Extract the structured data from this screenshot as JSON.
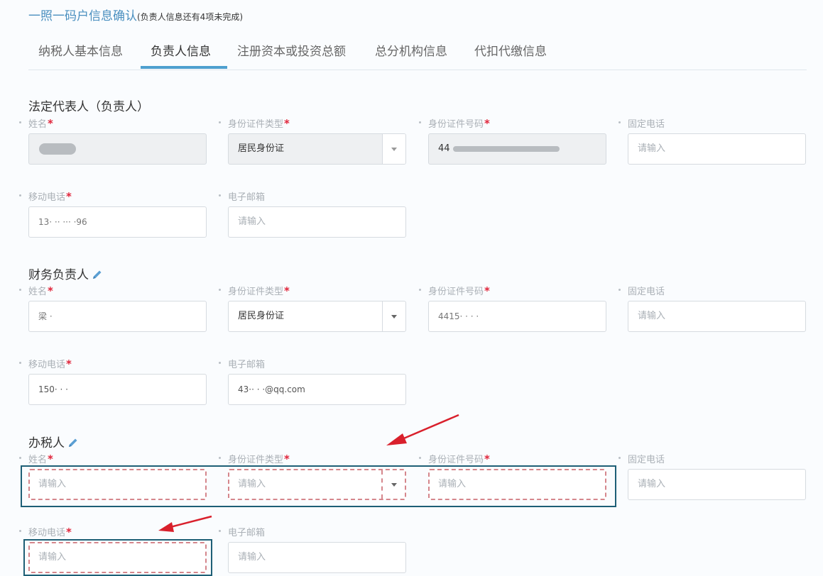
{
  "header": {
    "title": "一照一码户信息确认",
    "subtitle": "(负责人信息还有4项未完成)"
  },
  "tabs": [
    {
      "label": "纳税人基本信息"
    },
    {
      "label": "负责人信息"
    },
    {
      "label": "注册资本或投资总额"
    },
    {
      "label": "总分机构信息"
    },
    {
      "label": "代扣代缴信息"
    }
  ],
  "colors": {
    "accent": "#4ea0cf",
    "title": "#4a8fbf",
    "required": "#e0243a",
    "error_dash": "#d5868c",
    "highlight": "#1e5f76",
    "arrow": "#d9202c"
  },
  "legal_rep": {
    "title": "法定代表人（负责人）",
    "name": {
      "label": "姓名",
      "value": ""
    },
    "id_type": {
      "label": "身份证件类型",
      "value": "居民身份证"
    },
    "id_number": {
      "label": "身份证件号码",
      "value": "44"
    },
    "landline": {
      "label": "固定电话",
      "placeholder": "请输入"
    },
    "mobile": {
      "label": "移动电话",
      "value": "13· ·· ··· ·96"
    },
    "email": {
      "label": "电子邮箱",
      "placeholder": "请输入"
    }
  },
  "finance": {
    "title": "财务负责人",
    "name": {
      "label": "姓名",
      "value": "梁 ·"
    },
    "id_type": {
      "label": "身份证件类型",
      "value": "居民身份证"
    },
    "id_number": {
      "label": "身份证件号码",
      "value": "4415·           ·  · ·"
    },
    "landline": {
      "label": "固定电话",
      "placeholder": "请输入"
    },
    "mobile": {
      "label": "移动电话",
      "value": "150·  ·         ·"
    },
    "email": {
      "label": "电子邮箱",
      "value": "43·· ·  ·@qq.com"
    }
  },
  "tax_agent": {
    "title": "办税人",
    "name": {
      "label": "姓名",
      "placeholder": "请输入"
    },
    "id_type": {
      "label": "身份证件类型",
      "placeholder": "请输入"
    },
    "id_number": {
      "label": "身份证件号码",
      "placeholder": "请输入"
    },
    "landline": {
      "label": "固定电话",
      "placeholder": "请输入"
    },
    "mobile": {
      "label": "移动电话",
      "placeholder": "请输入"
    },
    "email": {
      "label": "电子邮箱",
      "placeholder": "请输入"
    }
  },
  "required_mark": "*"
}
